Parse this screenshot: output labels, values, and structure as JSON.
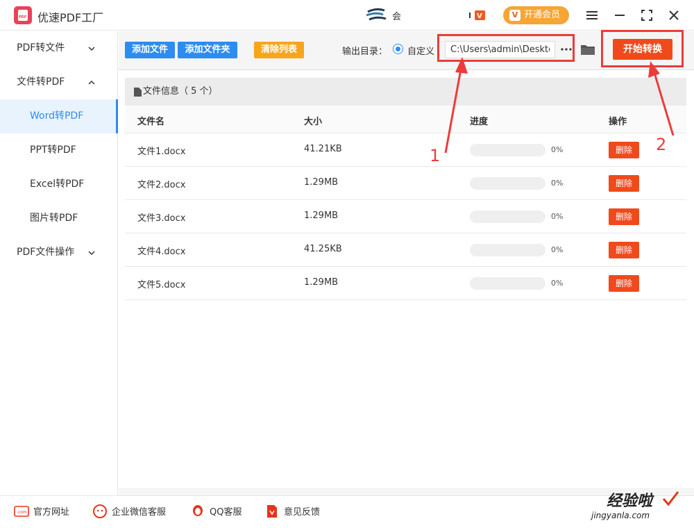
{
  "titlebar": {
    "app_title": "优速PDF工厂",
    "user_text": "会",
    "vip_label": "开通会员",
    "vip_badge": "V"
  },
  "sidebar": {
    "items": [
      {
        "label": "PDF转文件",
        "type": "group",
        "expanded": false
      },
      {
        "label": "文件转PDF",
        "type": "group",
        "expanded": true
      },
      {
        "label": "Word转PDF",
        "type": "sub",
        "active": true
      },
      {
        "label": "PPT转PDF",
        "type": "sub",
        "active": false
      },
      {
        "label": "Excel转PDF",
        "type": "sub",
        "active": false
      },
      {
        "label": "图片转PDF",
        "type": "sub",
        "active": false
      },
      {
        "label": "PDF文件操作",
        "type": "group",
        "expanded": false
      }
    ]
  },
  "toolbar": {
    "add_file": "添加文件",
    "add_folder": "添加文件夹",
    "clear_list": "清除列表",
    "output_label": "输出目录：",
    "custom_label": "自定义",
    "output_path": "C:\\Users\\admin\\Deskto",
    "start_label": "开始转换"
  },
  "file_table": {
    "info_label": "文件信息（ 5 个）",
    "columns": [
      "文件名",
      "大小",
      "进度",
      "操作"
    ],
    "rows": [
      {
        "name": "文件1.docx",
        "size": "41.21KB",
        "progress": "0%",
        "action": "删除"
      },
      {
        "name": "文件2.docx",
        "size": "1.29MB",
        "progress": "0%",
        "action": "删除"
      },
      {
        "name": "文件3.docx",
        "size": "1.29MB",
        "progress": "0%",
        "action": "删除"
      },
      {
        "name": "文件4.docx",
        "size": "41.25KB",
        "progress": "0%",
        "action": "删除"
      },
      {
        "name": "文件5.docx",
        "size": "1.29MB",
        "progress": "0%",
        "action": "删除"
      }
    ]
  },
  "annotations": {
    "label_1": "1",
    "label_2": "2",
    "color": "#ec3b3b"
  },
  "footer": {
    "website": "官方网址",
    "wechat": "企业微信客服",
    "qq": "QQ客服",
    "feedback": "意见反馈"
  },
  "watermark": {
    "main": "经验啦",
    "sub": "jingyanla.com"
  },
  "colors": {
    "accent": "#2d8cf0",
    "danger": "#f04a1c",
    "warning": "#f7a61c",
    "vip": "#f7a533"
  }
}
